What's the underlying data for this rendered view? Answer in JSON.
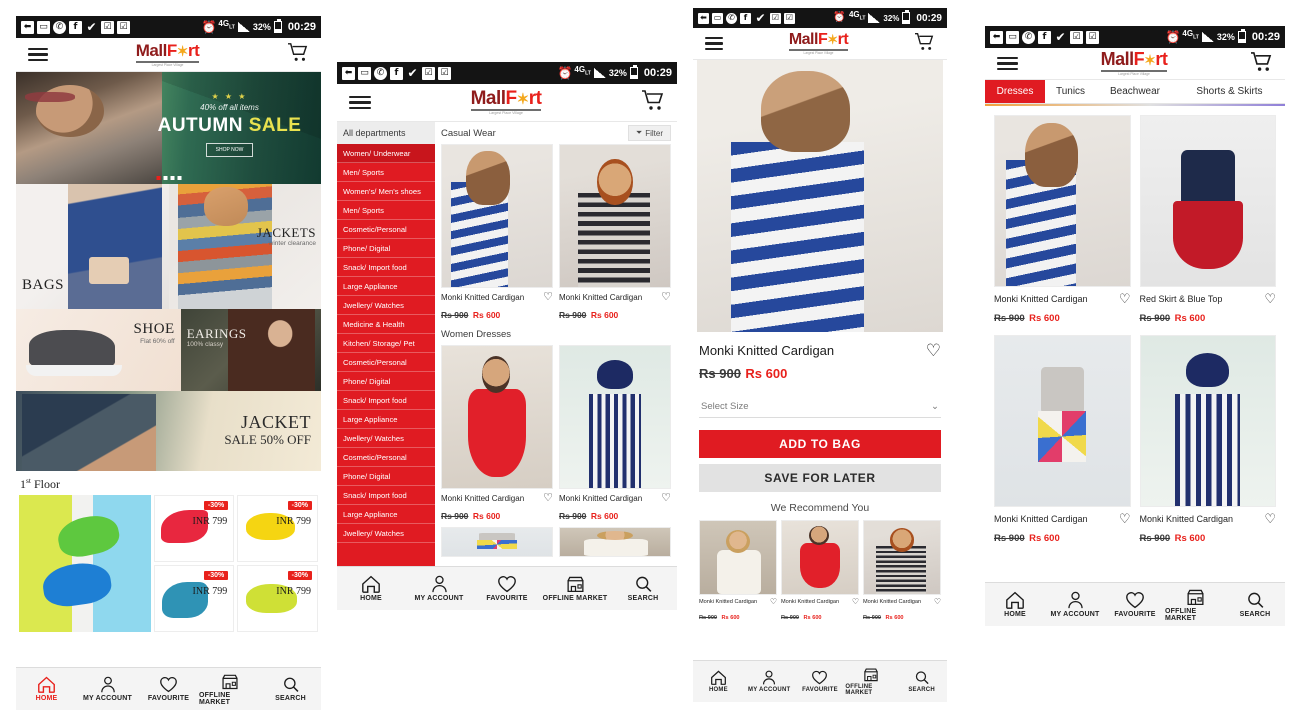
{
  "statusbar": {
    "icons": [
      "download-icon",
      "image-icon",
      "whatsapp-icon",
      "facebook-icon",
      "check-icon",
      "task-icon",
      "task-icon"
    ],
    "network": "4G",
    "network_sub": "LT",
    "battery": "32%",
    "time": "00:29"
  },
  "brand": {
    "name_part1": "Mall",
    "name_f": "F",
    "name_star": "✶",
    "name_rt": "rt",
    "tagline": "Largest Place Village"
  },
  "header": {
    "menu": "menu-icon",
    "cart": "cart-icon"
  },
  "screen1": {
    "hero": {
      "stars": "★ ★ ★",
      "subtitle": "40% off all items",
      "title_a": "AUTUMN",
      "title_b": "SALE",
      "button": "SHOP NOW",
      "dots": 4,
      "active_dot": 1
    },
    "tiles": [
      {
        "title": "BAGS",
        "subtitle": ""
      },
      {
        "title": "JACKETS",
        "subtitle": "winter clearance"
      },
      {
        "title": "SHOE",
        "subtitle": "Flat 60% off"
      },
      {
        "title": "EARINGS",
        "subtitle": "100% classy"
      },
      {
        "title": "JACKET",
        "subtitle": "SALE 50% OFF"
      }
    ],
    "floor_label": "1",
    "floor_label_sup": "st",
    "floor_label_rest": " Floor",
    "shoe_cells": [
      {
        "badge": "-30%",
        "price": "INR 799"
      },
      {
        "badge": "-30%",
        "price": "INR 799"
      },
      {
        "badge": "-30%",
        "price": "INR 799"
      },
      {
        "badge": "-30%",
        "price": "INR 799"
      }
    ]
  },
  "screen2": {
    "departments_header": "All departments",
    "departments": [
      "Women/ Underwear",
      "Men/ Sports",
      "Women's/ Men's shoes",
      "Men/ Sports",
      "Cosmetic/Personal",
      "Phone/ Digital",
      "Snack/ Import food",
      "Large Appliance",
      "Jwellery/ Watches",
      "Medicine & Health",
      "Kitchen/ Storage/ Pet",
      "Cosmetic/Personal",
      "Phone/ Digital",
      "Snack/ Import food",
      "Large Appliance",
      "Jwellery/ Watches",
      "Cosmetic/Personal",
      "Phone/ Digital",
      "Snack/ Import food",
      "Large Appliance",
      "Jwellery/ Watches"
    ],
    "selected_department": "Women/ Underwear",
    "sections": [
      {
        "title": "Casual Wear",
        "filter_label": "Filter",
        "products": [
          {
            "name": "Monki Knitted Cardigan",
            "old_price": "Rs 900",
            "new_price": "Rs 600"
          },
          {
            "name": "Monki Knitted Cardigan",
            "old_price": "Rs 900",
            "new_price": "Rs 600"
          }
        ]
      },
      {
        "title": "Women Dresses",
        "products": [
          {
            "name": "Monki Knitted Cardigan",
            "old_price": "Rs 900",
            "new_price": "Rs 600"
          },
          {
            "name": "Monki Knitted Cardigan",
            "old_price": "Rs 900",
            "new_price": "Rs 600"
          }
        ]
      }
    ]
  },
  "screen3": {
    "product": {
      "name": "Monki Knitted Cardigan",
      "old_price": "Rs 900",
      "new_price": "Rs 600"
    },
    "size_placeholder": "Select Size",
    "add_to_bag": "ADD TO BAG",
    "save_for_later": "SAVE FOR LATER",
    "recommend_title": "We Recommend You",
    "recommendations": [
      {
        "name": "Monki Knitted Cardigan",
        "old_price": "Rs 900",
        "new_price": "Rs 600"
      },
      {
        "name": "Monki Knitted Cardigan",
        "old_price": "Rs 900",
        "new_price": "Rs 600"
      },
      {
        "name": "Monki Knitted Cardigan",
        "old_price": "Rs 900",
        "new_price": "Rs 600"
      }
    ]
  },
  "screen4": {
    "tabs": [
      {
        "label": "Dresses",
        "active": true
      },
      {
        "label": "Tunics",
        "active": false
      },
      {
        "label": "Beachwear",
        "active": false
      },
      {
        "label": "Shorts & Skirts",
        "active": false
      }
    ],
    "products": [
      {
        "name": "Monki Knitted Cardigan",
        "old_price": "Rs 900",
        "new_price": "Rs 600"
      },
      {
        "name": "Red Skirt & Blue Top",
        "old_price": "Rs 900",
        "new_price": "Rs 600"
      },
      {
        "name": "Monki Knitted Cardigan",
        "old_price": "Rs 900",
        "new_price": "Rs 600"
      },
      {
        "name": "Monki Knitted Cardigan",
        "old_price": "Rs 900",
        "new_price": "Rs 600"
      }
    ]
  },
  "bottomnav": {
    "items": [
      {
        "label": "HOME",
        "icon": "home-icon",
        "active": true
      },
      {
        "label": "MY ACCOUNT",
        "icon": "user-icon",
        "active": false
      },
      {
        "label": "FAVOURITE",
        "icon": "heart-icon",
        "active": false
      },
      {
        "label": "OFFLINE MARKET",
        "icon": "store-icon",
        "active": false
      },
      {
        "label": "SEARCH",
        "icon": "search-icon",
        "active": false
      }
    ]
  },
  "colors": {
    "brand_red": "#e01b22",
    "accent_red": "#e8211c",
    "dark": "#141414"
  }
}
